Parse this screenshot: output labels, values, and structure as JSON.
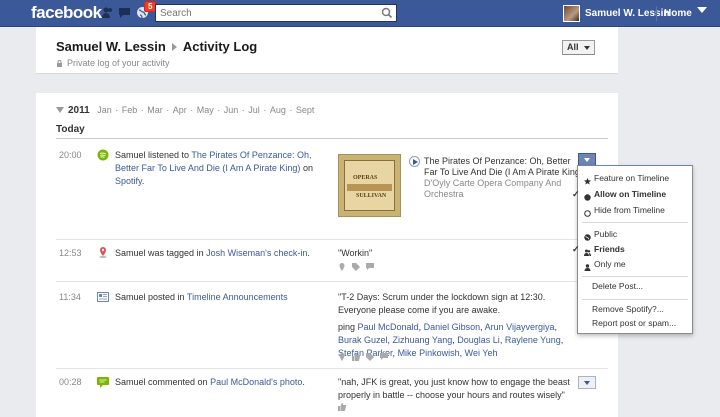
{
  "topbar": {
    "logo": "facebook",
    "notification_count": "5",
    "search_placeholder": "Search",
    "user_name": "Samuel W. Lessin",
    "home_label": "Home"
  },
  "header": {
    "owner": "Samuel W. Lessin",
    "page_title": "Activity Log",
    "subtitle": "Private log of your activity",
    "filter_label": "All"
  },
  "timeline": {
    "year": "2011",
    "months": [
      "Jan",
      "Feb",
      "Mar",
      "Apr",
      "May",
      "Jun",
      "Jul",
      "Aug",
      "Sept"
    ],
    "section": "Today"
  },
  "entries": [
    {
      "time": "20:00",
      "actor": "Samuel",
      "verb": "listened to",
      "link": "The Pirates Of Penzance: Oh, Better Far To Live And Die (I Am A Pirate King)",
      "suffix1": "on",
      "link2": "Spotify",
      "album_line1": "OPERAS",
      "album_line2": "SULLIVAN",
      "track_title": "The Pirates Of Penzance: Oh, Better Far To Live And Die (I Am A Pirate King)",
      "track_artist": "D'Oyly Carte Opera Company And Orchestra"
    },
    {
      "time": "12:53",
      "actor": "Samuel",
      "verb": "was tagged in",
      "link": "Josh Wiseman's check-in",
      "quote": "\"Workin\""
    },
    {
      "time": "11:34",
      "actor": "Samuel",
      "verb": "posted in",
      "link": "Timeline Announcements",
      "quote": "\"T-2 Days: Scrum under the lockdown sign at 12:30. Everyone please come if you are awake.",
      "ping_label": "ping",
      "ping_names": [
        "Paul McDonald",
        "Daniel Gibson",
        "Arun Vijayvergiya",
        "Burak Guzel",
        "Zizhuang Yang",
        "Douglas Li",
        "Raylene Yung",
        "Stefan Parker",
        "Mike Pinkowish",
        "Wei Yeh"
      ]
    },
    {
      "time": "00:28",
      "actor": "Samuel",
      "verb": "commented on",
      "link": "Paul McDonald's photo",
      "quote": "\"nah, JFK is great, you just know how to engage the beast properly in battle -- choose your hours and routes wisely\""
    }
  ],
  "menu": {
    "feature": "Feature on Timeline",
    "allow": "Allow on Timeline",
    "hide": "Hide from Timeline",
    "public": "Public",
    "friends": "Friends",
    "only_me": "Only me",
    "delete": "Delete Post...",
    "remove": "Remove Spotify?...",
    "report": "Report post or spam..."
  },
  "colors": {
    "brand": "#3b5998",
    "link": "#3b5998",
    "badge": "#f03d25"
  }
}
